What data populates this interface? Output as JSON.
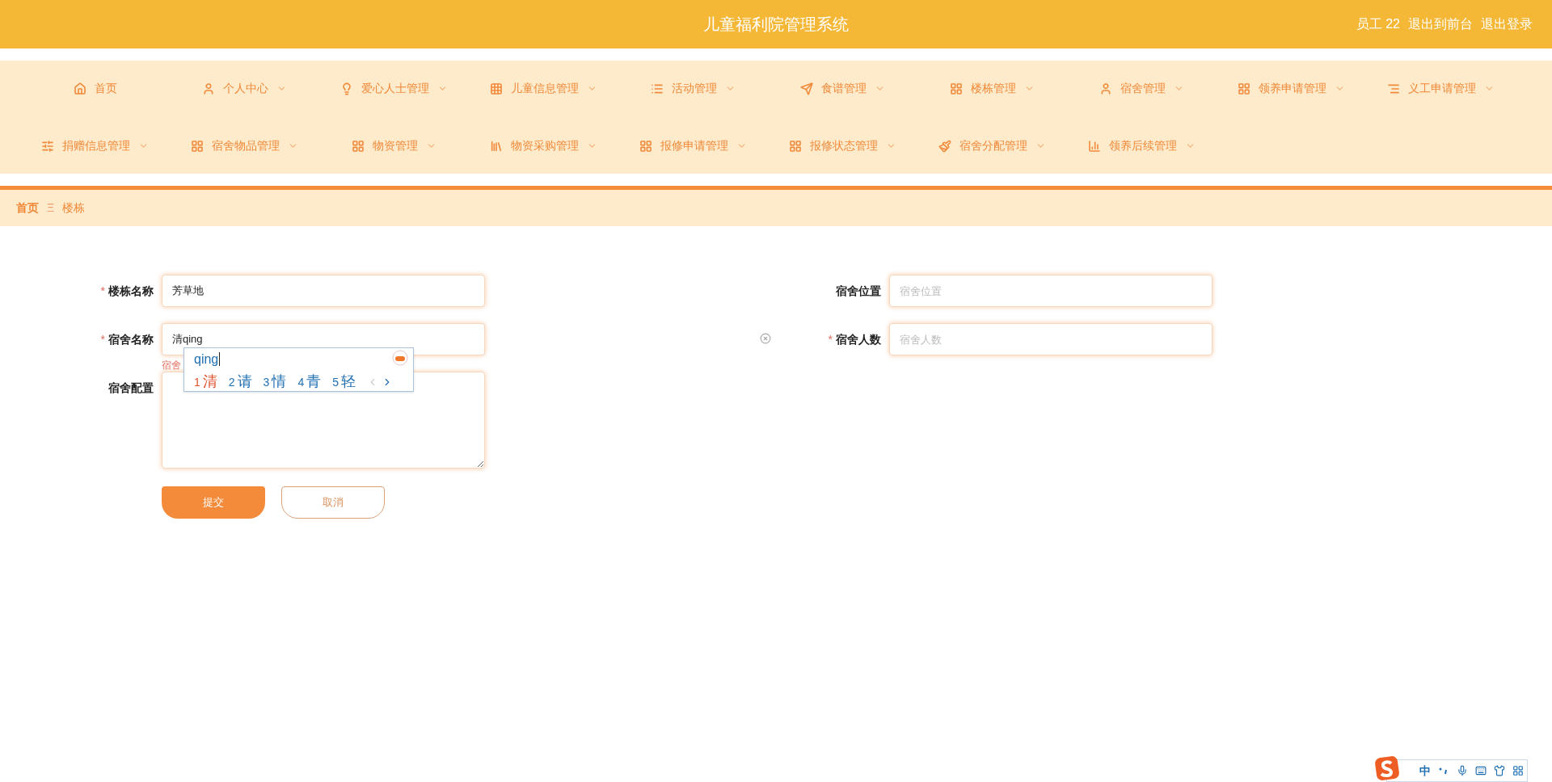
{
  "header": {
    "title": "儿童福利院管理系统",
    "user": "员工 22",
    "links": [
      "退出到前台",
      "退出登录"
    ]
  },
  "nav": [
    [
      {
        "label": "首页",
        "dropdown": false
      },
      {
        "label": "个人中心",
        "dropdown": true
      },
      {
        "label": "爱心人士管理",
        "dropdown": true
      },
      {
        "label": "儿童信息管理",
        "dropdown": true
      },
      {
        "label": "活动管理",
        "dropdown": true
      },
      {
        "label": "食谱管理",
        "dropdown": true
      },
      {
        "label": "楼栋管理",
        "dropdown": true
      },
      {
        "label": "宿舍管理",
        "dropdown": true
      },
      {
        "label": "领养申请管理",
        "dropdown": true
      },
      {
        "label": "义工申请管理",
        "dropdown": true
      }
    ],
    [
      {
        "label": "捐赠信息管理",
        "dropdown": true
      },
      {
        "label": "宿舍物品管理",
        "dropdown": true
      },
      {
        "label": "物资管理",
        "dropdown": true
      },
      {
        "label": "物资采购管理",
        "dropdown": true
      },
      {
        "label": "报修申请管理",
        "dropdown": true
      },
      {
        "label": "报修状态管理",
        "dropdown": true
      },
      {
        "label": "宿舍分配管理",
        "dropdown": true
      },
      {
        "label": "领养后续管理",
        "dropdown": true
      }
    ]
  ],
  "breadcrumb": {
    "items": [
      "首页",
      "楼栋"
    ],
    "separator": "Ξ"
  },
  "form": {
    "left": [
      {
        "kind": "input",
        "label": "楼栋名称",
        "required_mark": "*",
        "value": "芳草地"
      },
      {
        "kind": "input",
        "label": "宿舍名称",
        "required_mark": "*",
        "value": "清qing",
        "error": "宿舍"
      },
      {
        "kind": "textarea",
        "label": "宿舍配置"
      }
    ],
    "right": [
      {
        "label": "宿舍位置",
        "placeholder": "宿舍位置"
      },
      {
        "label": "宿舍人数",
        "required_mark": "*",
        "placeholder": "宿舍人数"
      }
    ],
    "buttons": [
      "提交",
      "取消"
    ]
  },
  "ime": {
    "composition": "qing",
    "candidates": [
      {
        "index": "1",
        "text": "清",
        "selected": true
      },
      {
        "index": "2",
        "text": "请",
        "selected": false
      },
      {
        "index": "3",
        "text": "情",
        "selected": false
      },
      {
        "index": "4",
        "text": "青",
        "selected": false
      },
      {
        "index": "5",
        "text": "轻",
        "selected": false
      }
    ],
    "toolbar": {
      "mode": "中"
    }
  }
}
